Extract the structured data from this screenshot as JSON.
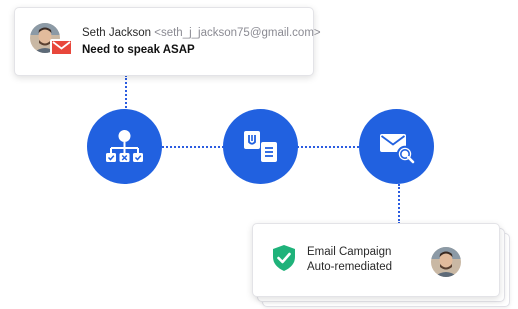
{
  "email": {
    "sender_name": "Seth Jackson",
    "sender_email": "<seth_j_jackson75@gmail.com>",
    "subject": "Need to speak ASAP"
  },
  "workflow": {
    "nodes": [
      {
        "icon": "org-chart-checklist-icon"
      },
      {
        "icon": "attachment-document-icon"
      },
      {
        "icon": "email-search-icon"
      }
    ]
  },
  "result": {
    "title": "Email Campaign",
    "status": "Auto-remediated",
    "icon": "shield-check-icon"
  },
  "colors": {
    "accent": "#2161e0",
    "shield": "#1fb27a",
    "mail_badge": "#e8473b"
  }
}
